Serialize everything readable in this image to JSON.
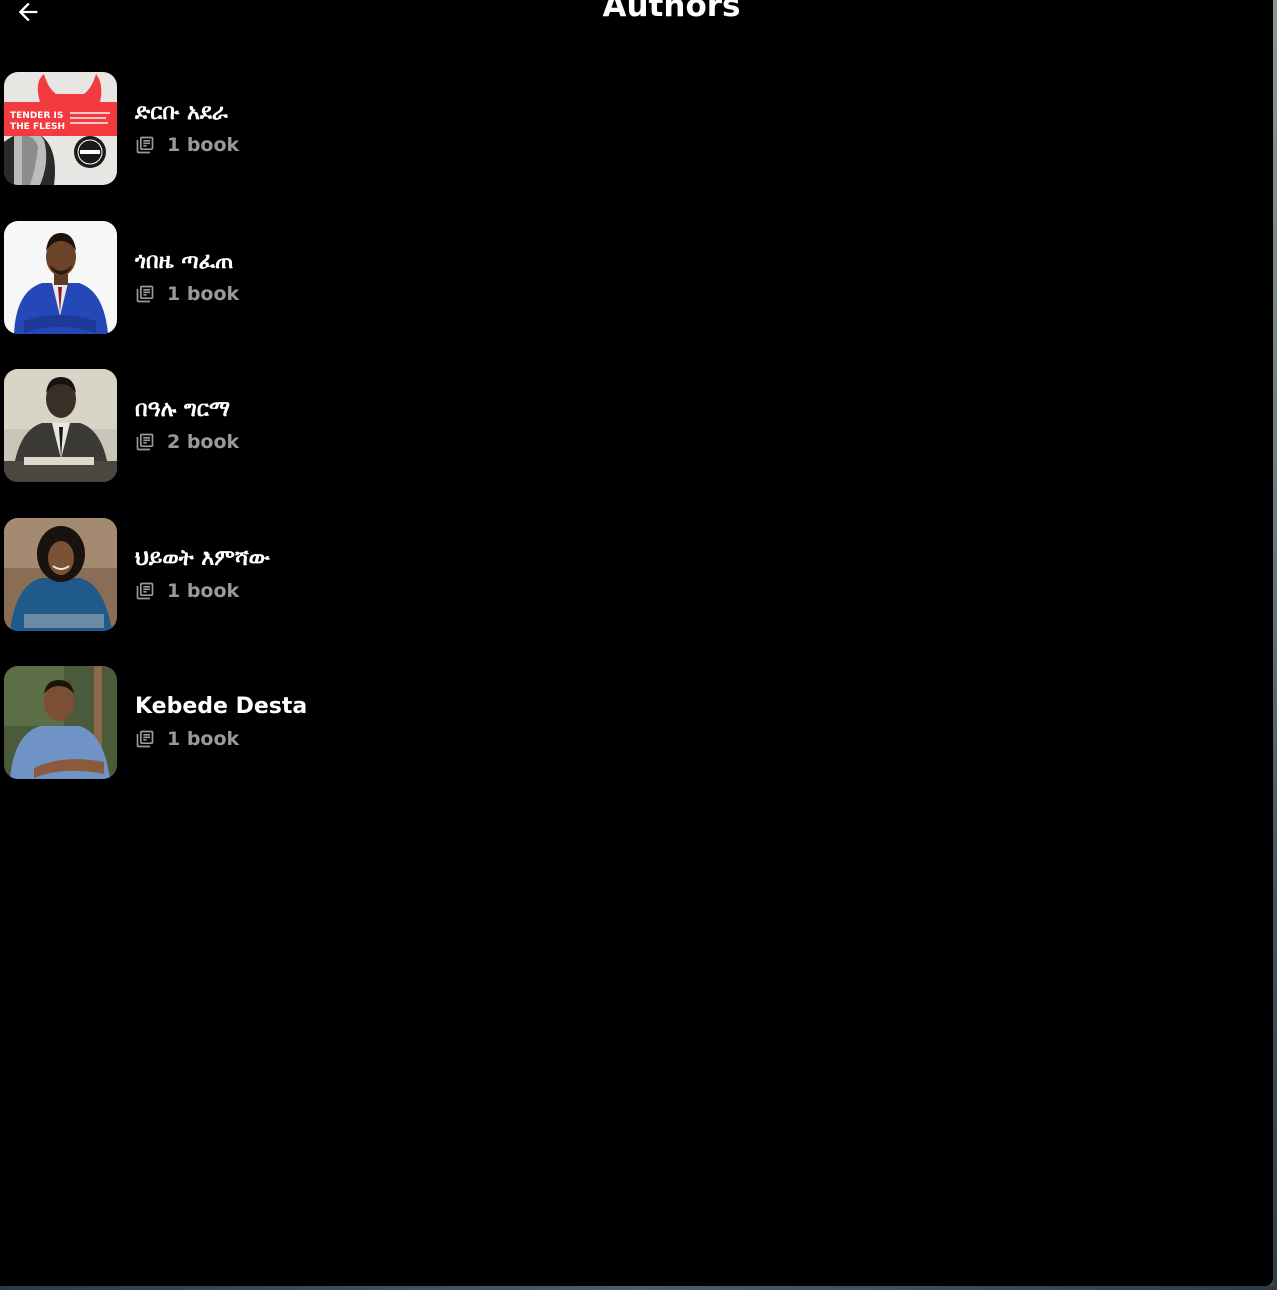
{
  "header": {
    "title": "Authors",
    "back_icon": "arrow-left-icon"
  },
  "authors": [
    {
      "name": "ድርቡ አደራ",
      "book_count": "1 book",
      "avatar": "book-cover-tender-is-the-flesh",
      "avatar_text": "TENDER IS THE FLESH"
    },
    {
      "name": "ጎበዜ ጣፈጠ",
      "book_count": "1 book",
      "avatar": "portrait-man-blue-suit"
    },
    {
      "name": "በዓሉ ግርማ",
      "book_count": "2 book",
      "avatar": "portrait-man-vintage-photo"
    },
    {
      "name": "ህይወት እምሻው",
      "book_count": "1 book",
      "avatar": "portrait-woman-blue-shirt"
    },
    {
      "name": "Kebede Desta",
      "book_count": "1 book",
      "avatar": "portrait-man-denim-shirt"
    }
  ],
  "colors": {
    "background": "#000000",
    "title_text": "#ffffff",
    "secondary_text": "#9a9a9a"
  },
  "icons": {
    "book_count": "library-books-icon"
  }
}
